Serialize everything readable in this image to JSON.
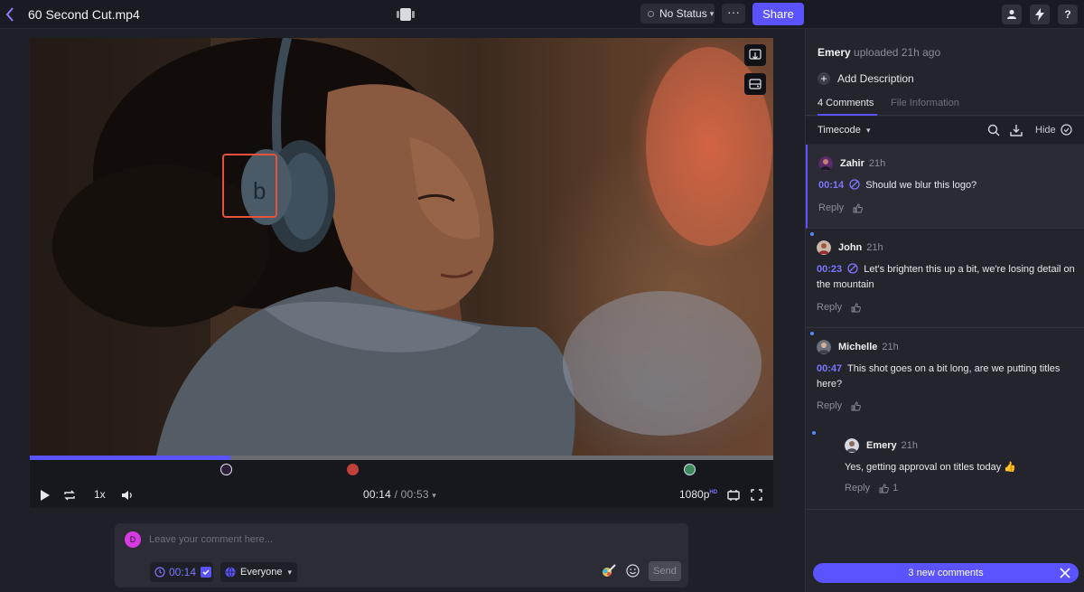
{
  "topbar": {
    "file_name": "60 Second Cut.mp4",
    "status_label": "No Status",
    "more_label": "···",
    "share_label": "Share",
    "help_label": "?"
  },
  "player": {
    "progress": 0.27,
    "playback_rate": "1x",
    "current_time": "00:14",
    "separator": "/",
    "duration": "00:53",
    "resolution": "1080p",
    "resolution_badge": "HD",
    "comment_marker_times": [
      "00:14",
      "00:23",
      "00:47"
    ]
  },
  "composer": {
    "avatar_letter": "D",
    "placeholder": "Leave your comment here...",
    "timecode": "00:14",
    "visibility": "Everyone",
    "send_label": "Send"
  },
  "panel": {
    "uploader_name": "Emery",
    "uploaded_text": "uploaded 21h ago",
    "add_description": "Add Description",
    "tabs": [
      {
        "label": "4 Comments"
      },
      {
        "label": "File Information"
      }
    ],
    "sort_label": "Timecode",
    "hide_label": "Hide",
    "comments": [
      {
        "author": "Zahir",
        "time": "21h",
        "timecode": "00:14",
        "text": "Should we blur this logo?",
        "reply": "Reply",
        "likes": ""
      },
      {
        "author": "John",
        "time": "21h",
        "timecode": "00:23",
        "text": "Let's brighten this up a bit, we're losing detail on the mountain",
        "reply": "Reply",
        "likes": ""
      },
      {
        "author": "Michelle",
        "time": "21h",
        "timecode": "00:47",
        "text": "This shot goes on a bit long, are we putting titles here?",
        "reply": "Reply",
        "likes": ""
      },
      {
        "author": "Emery",
        "time": "21h",
        "timecode": "",
        "text": "Yes, getting approval on titles today 👍",
        "reply": "Reply",
        "likes": "1"
      }
    ],
    "new_comments_label": "3 new comments"
  },
  "colors": {
    "accent": "#5b53ff",
    "timecode": "#7e76ff",
    "annotation": "#e5533c"
  }
}
